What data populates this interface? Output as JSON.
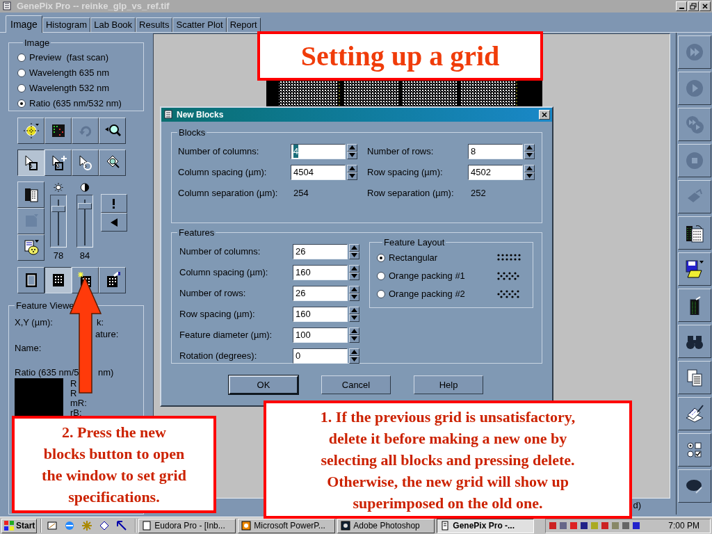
{
  "window": {
    "title": "GenePix Pro -- reinke_glp_vs_ref.tif"
  },
  "tabs": [
    {
      "label": "Image",
      "selected": true
    },
    {
      "label": "Histogram",
      "selected": false
    },
    {
      "label": "Lab Book",
      "selected": false
    },
    {
      "label": "Results",
      "selected": false
    },
    {
      "label": "Scatter Plot",
      "selected": false
    },
    {
      "label": "Report",
      "selected": false
    }
  ],
  "image_group": {
    "title": "Image",
    "options": [
      {
        "label": "Preview  (fast scan)",
        "selected": false
      },
      {
        "label": "Wavelength 635 nm",
        "selected": false
      },
      {
        "label": "Wavelength 532 nm",
        "selected": false
      },
      {
        "label": "Ratio (635 nm/532 nm)",
        "selected": true
      }
    ]
  },
  "tool_rows": [
    [
      {
        "pressed": false
      },
      {
        "pressed": false
      },
      {
        "pressed": false
      },
      {
        "pressed": false
      }
    ],
    [
      {
        "pressed": true
      },
      {
        "pressed": false
      },
      {
        "pressed": false
      },
      {
        "pressed": false
      }
    ],
    [
      {
        "pressed": false
      },
      {
        "pressed": true
      },
      {
        "pressed": false
      },
      {
        "pressed": false
      }
    ]
  ],
  "sliders": [
    {
      "level": 0.78,
      "reading": "78"
    },
    {
      "level": 0.84,
      "reading": "84"
    }
  ],
  "feature_viewer": {
    "title": "Feature Viewe",
    "labels": [
      "X,Y (µm):",
      "k:",
      "ature:",
      "Name:",
      "Ratio (635 nm/5",
      "nm)",
      "R",
      "R",
      "mR:",
      "rB:"
    ]
  },
  "status_bar": {
    "text": "d)"
  },
  "right_tools": [
    {
      "disabled": true
    },
    {
      "disabled": true
    },
    {
      "disabled": true
    },
    {
      "disabled": true
    },
    {
      "disabled": true
    },
    {
      "disabled": false
    },
    {
      "disabled": false
    },
    {
      "disabled": false
    },
    {
      "disabled": false
    },
    {
      "disabled": false
    },
    {
      "disabled": false
    },
    {
      "disabled": false
    },
    {
      "disabled": false
    }
  ],
  "dialog": {
    "title": "New Blocks",
    "blocks": {
      "title": "Blocks",
      "fields": [
        {
          "label": "Number of columns:",
          "value": "4",
          "highlighted": true
        },
        {
          "label": "Number of rows:",
          "value": "8",
          "highlighted": false
        },
        {
          "label": "Column spacing (µm):",
          "value": "4504",
          "highlighted": false
        },
        {
          "label": "Row spacing (µm):",
          "value": "4502",
          "highlighted": false
        }
      ],
      "readouts": [
        {
          "label": "Column separation (µm):",
          "value": "254"
        },
        {
          "label": "Row separation (µm):",
          "value": "252"
        }
      ]
    },
    "features": {
      "title": "Features",
      "fields": [
        {
          "label": "Number of columns:",
          "value": "26",
          "highlighted": false
        },
        {
          "label": "Column spacing (µm):",
          "value": "160",
          "highlighted": false
        },
        {
          "label": "Number of rows:",
          "value": "26",
          "highlighted": false
        },
        {
          "label": "Row spacing (µm):",
          "value": "160",
          "highlighted": false
        },
        {
          "label": "Feature diameter (µm):",
          "value": "100",
          "highlighted": false
        },
        {
          "label": "Rotation (degrees):",
          "value": "0",
          "highlighted": false
        }
      ]
    },
    "layout": {
      "title": "Feature Layout",
      "options": [
        {
          "label": "Rectangular",
          "selected": true
        },
        {
          "label": "Orange packing #1",
          "selected": false
        },
        {
          "label": "Orange packing #2",
          "selected": false
        }
      ]
    },
    "buttons": [
      {
        "label": "OK",
        "default": true
      },
      {
        "label": "Cancel",
        "default": false
      },
      {
        "label": "Help",
        "default": false
      }
    ]
  },
  "taskbar": {
    "start": "Start",
    "tasks": [
      {
        "label": "Eudora Pro - [Inb...",
        "selected": false
      },
      {
        "label": "Microsoft PowerP...",
        "selected": false
      },
      {
        "label": "Adobe Photoshop",
        "selected": false
      },
      {
        "label": "GenePix Pro -...",
        "selected": true
      }
    ],
    "clock": "7:00 PM"
  },
  "callouts": [
    {
      "kind": "title",
      "text": "Setting up a grid"
    },
    {
      "kind": "note",
      "text": "2.  Press the new\nblocks button to open\nthe window to set grid\nspecifications."
    },
    {
      "kind": "note",
      "text": "1.  If the previous grid is unsatisfactory,\ndelete it before making a new one by\nselecting all blocks and pressing delete.\nOtherwise, the new grid will show up\nsuperimposed on the old one."
    }
  ]
}
